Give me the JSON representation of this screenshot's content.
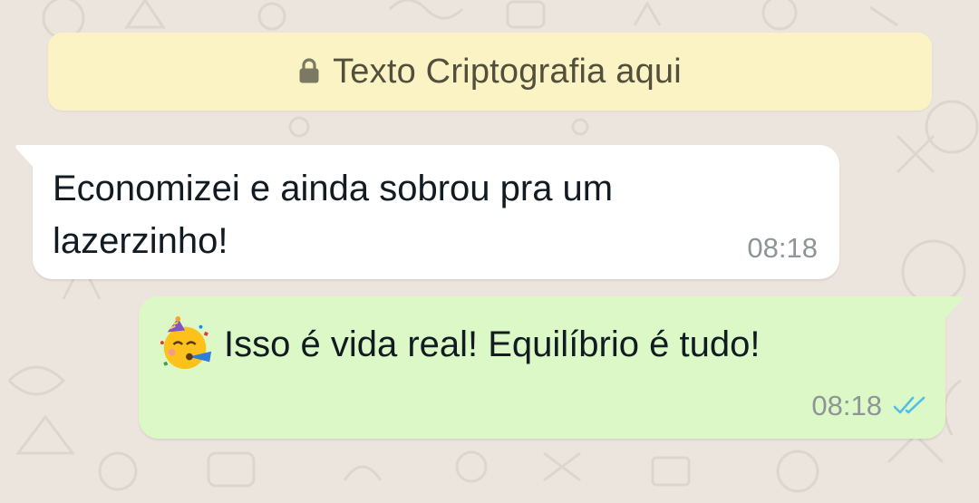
{
  "banner": {
    "icon": "lock-icon",
    "text": "Texto Criptografia aqui"
  },
  "messages": [
    {
      "direction": "incoming",
      "text": "Economizei e ainda sobrou pra um lazerzinho!",
      "time": "08:18"
    },
    {
      "direction": "outgoing",
      "emoji": "partying-face-emoji",
      "text": "Isso é vida real! Equilíbrio é tudo!",
      "time": "08:18",
      "status": "read"
    }
  ],
  "colors": {
    "background": "#ece5dd",
    "banner": "#fcf3c5",
    "incoming_bubble": "#ffffff",
    "outgoing_bubble": "#dcf8c6",
    "read_ticks": "#53bdeb"
  }
}
